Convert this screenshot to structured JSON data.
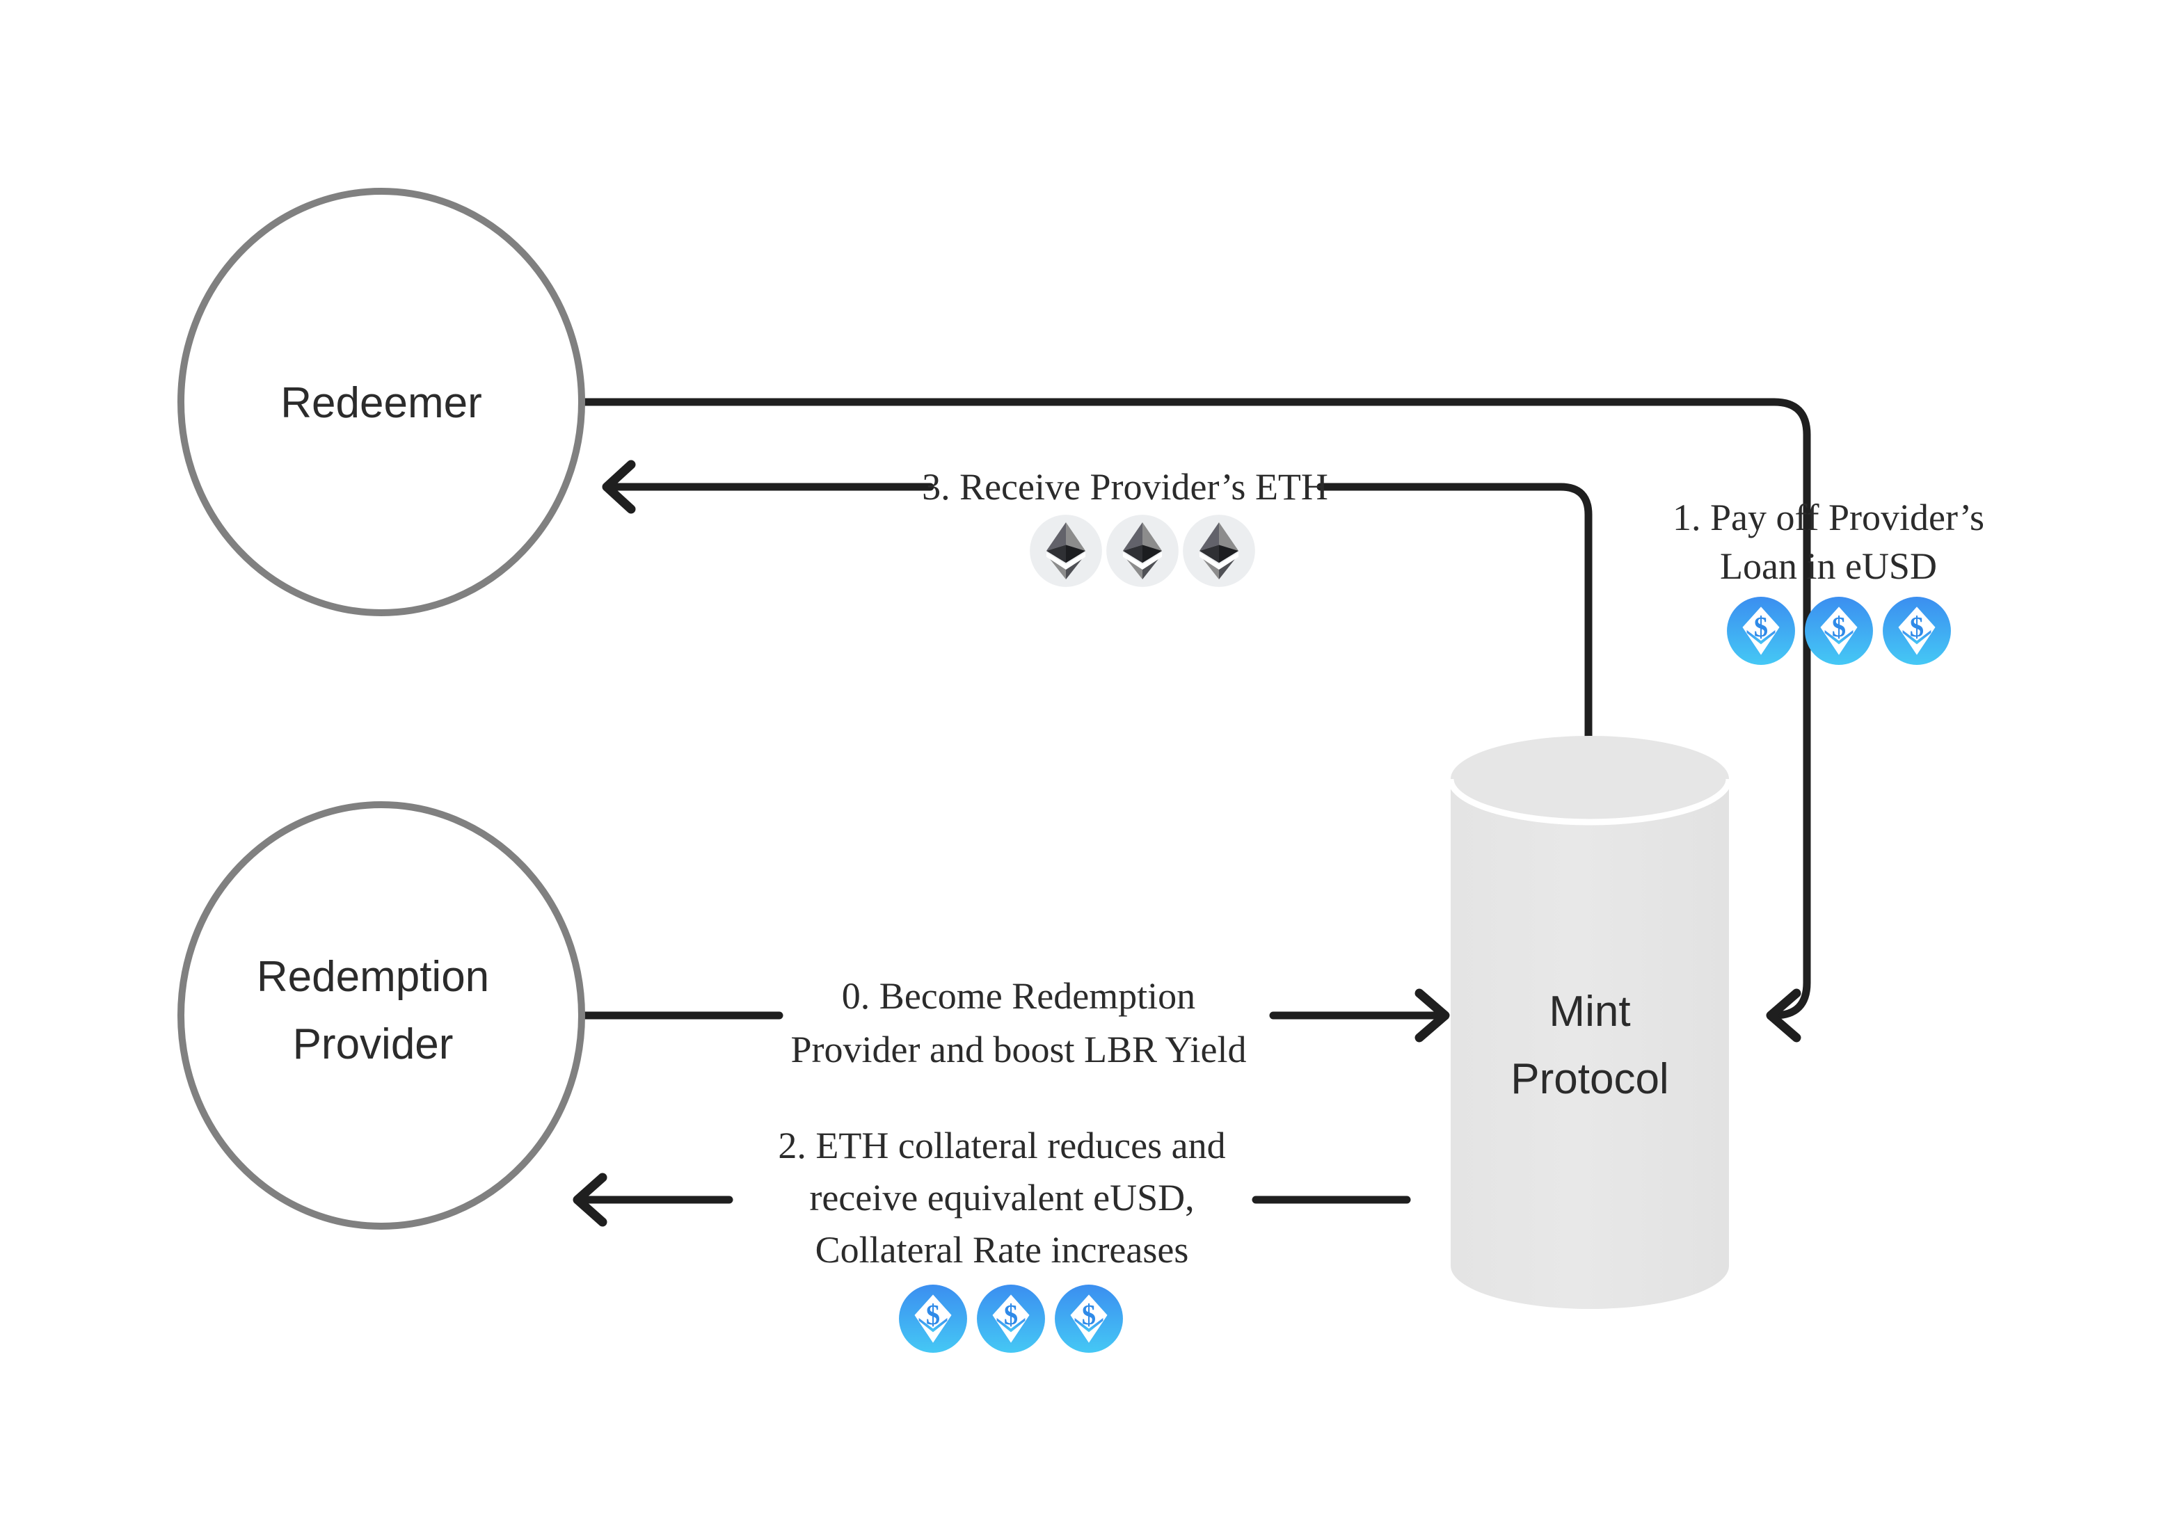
{
  "diagram": {
    "title": "Redemption Flow",
    "background_color": "#ffffff",
    "line_color": "#1f1f1f",
    "node_stroke_color": "#808080",
    "text_color": "#2b2b2b",
    "cylinder_fill": "#e6e6e6",
    "eth_icon_bg": "#eceef0",
    "eth_icon_color": "#3c3c3d",
    "eusd_gradient_top": "#3b8ef0",
    "eusd_gradient_bottom": "#45c8f5"
  },
  "nodes": [
    {
      "id": "redeemer",
      "shape": "ellipse",
      "label_lines": [
        "Redeemer"
      ]
    },
    {
      "id": "redemption-provider",
      "shape": "ellipse",
      "label_lines": [
        "Redemption",
        "Provider"
      ]
    },
    {
      "id": "mint-protocol",
      "shape": "cylinder",
      "label_lines": [
        "Mint",
        "Protocol"
      ]
    }
  ],
  "steps": [
    {
      "id": "step-0",
      "number": "0.",
      "lines": [
        "0. Become Redemption",
        "Provider and boost LBR Yield"
      ],
      "from": "redemption-provider",
      "to": "mint-protocol",
      "icons": []
    },
    {
      "id": "step-1",
      "number": "1.",
      "lines": [
        "1. Pay off Provider’s",
        "Loan in eUSD"
      ],
      "from": "redeemer",
      "to": "mint-protocol",
      "icons": [
        "eusd-coin-icon",
        "eusd-coin-icon",
        "eusd-coin-icon"
      ]
    },
    {
      "id": "step-2",
      "number": "2.",
      "lines": [
        "2.  ETH collateral reduces and",
        "receive equivalent eUSD,",
        "Collateral Rate increases"
      ],
      "from": "mint-protocol",
      "to": "redemption-provider",
      "icons": [
        "eusd-coin-icon",
        "eusd-coin-icon",
        "eusd-coin-icon"
      ]
    },
    {
      "id": "step-3",
      "number": "3.",
      "lines": [
        "3.  Receive Provider’s ETH"
      ],
      "from": "mint-protocol",
      "to": "redeemer",
      "icons": [
        "eth-coin-icon",
        "eth-coin-icon",
        "eth-coin-icon"
      ]
    }
  ]
}
